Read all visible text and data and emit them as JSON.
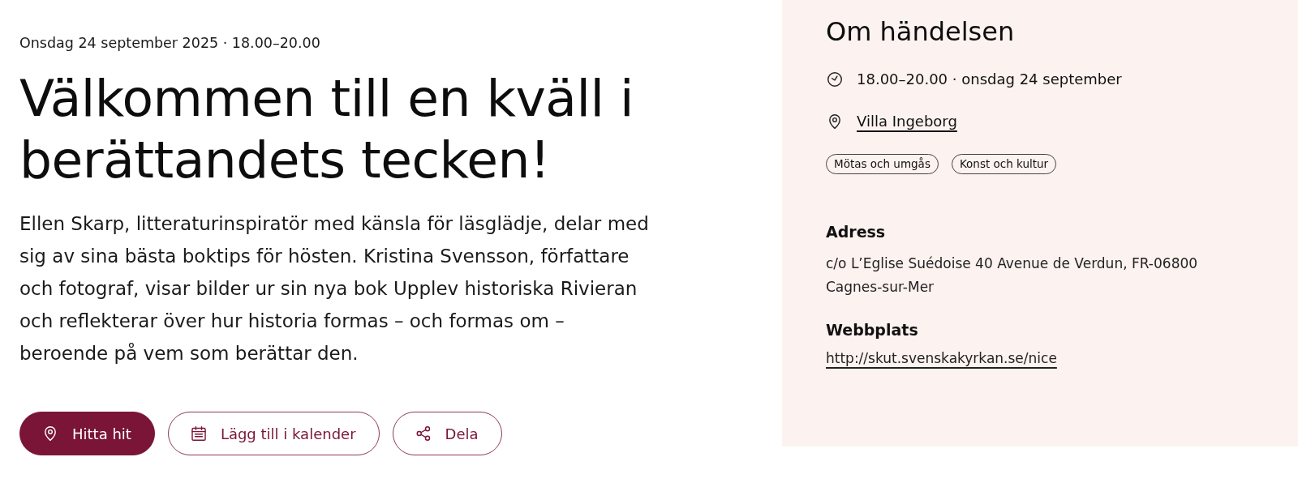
{
  "event": {
    "date_time": "Onsdag 24 september 2025 · 18.00–20.00",
    "title": "Välkommen till en kväll i berättandets tecken!",
    "description": "Ellen Skarp, litteraturinspiratör med känsla för läsglädje, delar med sig av sina bästa boktips för hösten. Kristina Svensson, författare och fotograf, visar bilder ur sin nya bok Upplev historiska Rivieran och reflekterar över hur historia formas – och formas om – beroende på vem som berättar den."
  },
  "actions": [
    {
      "kind": "directions",
      "label": "Hitta hit"
    },
    {
      "kind": "calendar",
      "label": "Lägg till i kalender"
    },
    {
      "kind": "share",
      "label": "Dela"
    }
  ],
  "about": {
    "heading": "Om händelsen",
    "details": [
      {
        "kind": "time",
        "text": "18.00–20.00 · onsdag 24 september"
      },
      {
        "kind": "location",
        "text": "Villa Ingeborg"
      }
    ],
    "tags": [
      "Mötas och umgås",
      "Konst och kultur"
    ],
    "address": {
      "label": "Adress",
      "text": "c/o L’Eglise Suédoise 40 Avenue de Verdun, FR-06800 Cagnes-sur-Mer"
    },
    "website": {
      "label": "Webbplats",
      "url": "http://skut.svenskakyrkan.se/nice"
    }
  }
}
